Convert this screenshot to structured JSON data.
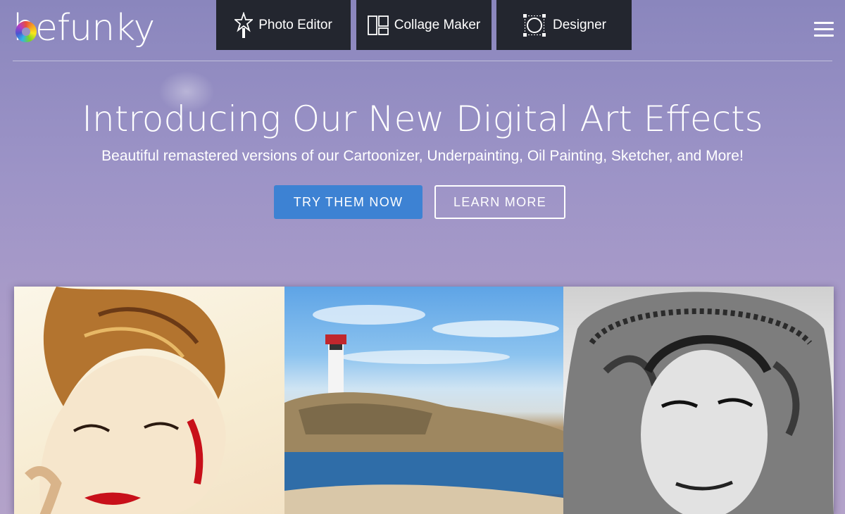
{
  "brand": {
    "logo_text": "befunky"
  },
  "nav": {
    "tabs": [
      {
        "label": "Photo Editor",
        "icon": "star-wand-icon"
      },
      {
        "label": "Collage Maker",
        "icon": "collage-grid-icon"
      },
      {
        "label": "Designer",
        "icon": "designer-circle-icon"
      }
    ],
    "menu_icon": "hamburger-menu-icon"
  },
  "hero": {
    "title": "Introducing Our New Digital Art Effects",
    "subtitle": "Beautiful remastered versions of our Cartoonizer, Underpainting, Oil Painting, Sketcher, and More!",
    "primary_button": "TRY THEM NOW",
    "secondary_button": "LEARN MORE"
  },
  "colors": {
    "nav_background": "#23262f",
    "primary_button": "#3d82d3",
    "page_background": "#9d94c7"
  }
}
